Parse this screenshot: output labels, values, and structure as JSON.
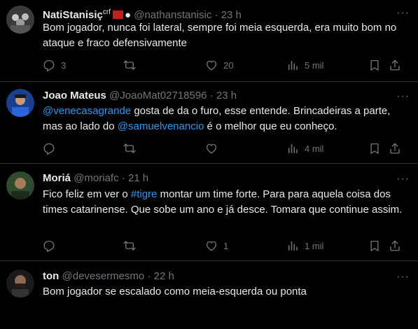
{
  "tweets": [
    {
      "name": "NatiStanisiç",
      "name_suffix": "crf",
      "apple_glyph": "",
      "handle": "@nathanstanisic",
      "time": "23 h",
      "text_plain": "Bom jogador, nunca foi lateral, sempre foi meia esquerda, era muito bom no ataque e fraco defensivamente",
      "replies": "3",
      "retweets": "",
      "likes": "20",
      "views": "5 mil"
    },
    {
      "name": "Joao Mateus",
      "handle": "@JoaoMat02718596",
      "time": "23 h",
      "mention1": "@venecasagrande",
      "text_a": " gosta de da o furo, esse entende. Brincadeiras a parte, mas ao lado do ",
      "mention2": "@samuelvenancio",
      "text_b": " é o melhor que eu conheço.",
      "replies": "",
      "retweets": "",
      "likes": "",
      "views": "4 mil"
    },
    {
      "name": "Moriá",
      "handle": "@moriafc",
      "time": "21 h",
      "text_a": "Fico feliz em ver o ",
      "hashtag": "#tigre",
      "text_b": " montar um time forte. Para para aquela coisa dos times catarinense.  Que sobe um ano e já desce. Tomara que continue assim.",
      "replies": "",
      "retweets": "",
      "likes": "1",
      "views": "1 mil"
    },
    {
      "name": "ton",
      "handle": "@devesermesmo",
      "time": "22 h",
      "text_plain": "Bom jogador se escalado como meia-esquerda ou ponta"
    }
  ],
  "separator": "·",
  "more_glyph": "···",
  "icons": [
    "reply-icon",
    "retweet-icon",
    "like-icon",
    "views-icon",
    "bookmark-icon",
    "share-icon",
    "more-icon"
  ],
  "colors": {
    "background": "#000000",
    "text": "#e7e9ea",
    "muted": "#71767b",
    "link": "#1d9bf0",
    "border": "#2f3336"
  }
}
